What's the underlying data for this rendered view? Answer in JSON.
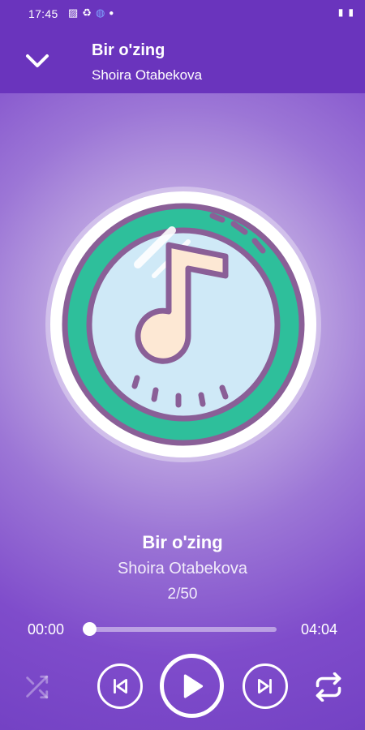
{
  "status_bar": {
    "time": "17:45",
    "icons": [
      "image-icon",
      "sync-icon",
      "vpn-icon",
      "dot-icon",
      "signal-icon",
      "battery-icon"
    ]
  },
  "header": {
    "title": "Bir o'zing",
    "artist": "Shoira Otabekova",
    "collapse_icon": "chevron-down-icon",
    "background": "#6a34bd"
  },
  "track_info": {
    "title": "Bir o'zing",
    "artist": "Shoira Otabekova",
    "position": "2/50"
  },
  "progress": {
    "current_time": "00:00",
    "total_time": "04:04",
    "fraction": 0.0
  },
  "controls": {
    "shuffle_icon": "shuffle-icon",
    "previous_icon": "skip-previous-icon",
    "play_icon": "play-icon",
    "next_icon": "skip-next-icon",
    "repeat_icon": "repeat-icon"
  },
  "colors": {
    "accent": "#6a34bd",
    "art_ring": "#2ebf9b",
    "art_outline": "#8a5f97",
    "art_glass": "#cfe9f7",
    "note_fill": "#fde8d4"
  }
}
